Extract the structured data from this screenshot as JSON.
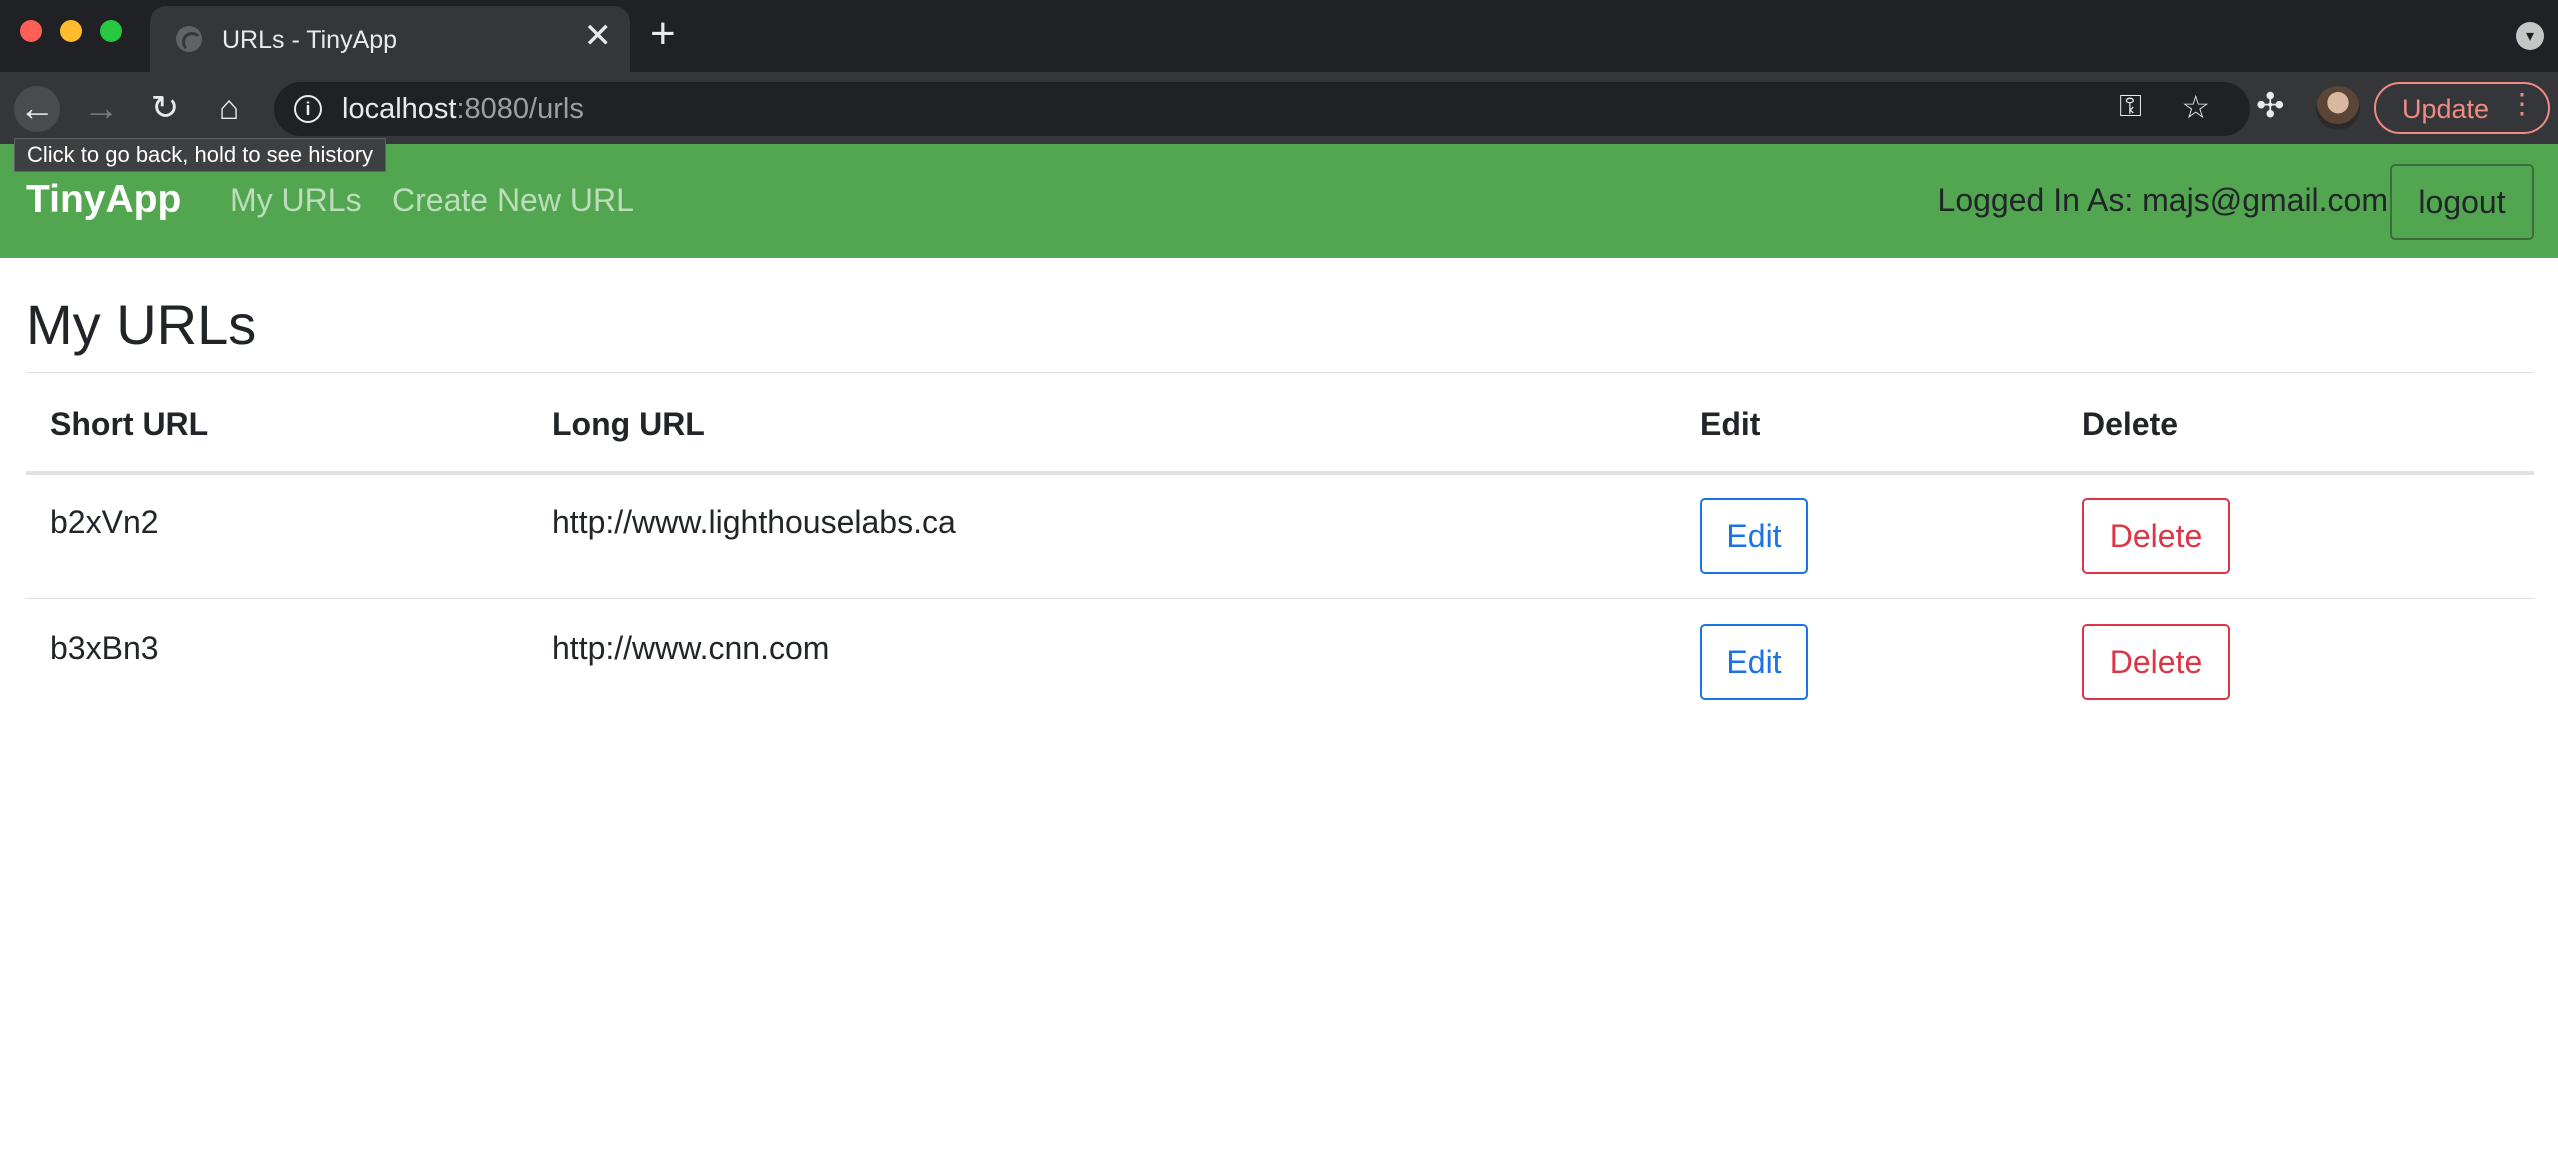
{
  "browser": {
    "tab_title": "URLs - TinyApp",
    "close_glyph": "✕",
    "new_tab_glyph": "+",
    "tab_menu_glyph": "▾",
    "back_glyph": "←",
    "forward_glyph": "→",
    "reload_glyph": "↻",
    "home_glyph": "⌂",
    "info_glyph": "i",
    "url_host": "localhost",
    "url_rest": ":8080/urls",
    "key_glyph": "⚿",
    "star_glyph": "☆",
    "extensions_glyph": "✣",
    "update_label": "Update",
    "menu_glyph": "⋮",
    "tooltip": "Click to go back, hold to see history"
  },
  "nav": {
    "brand": "TinyApp",
    "my_urls": "My URLs",
    "create_new": "Create New URL",
    "logged_in": "Logged In As: majs@gmail.com",
    "logout": "logout"
  },
  "main": {
    "title": "My URLs",
    "headers": [
      "Short URL",
      "Long URL",
      "Edit",
      "Delete"
    ],
    "rows": [
      {
        "short": "b2xVn2",
        "long": "http://www.lighthouselabs.ca",
        "edit": "Edit",
        "delete": "Delete"
      },
      {
        "short": "b3xBn3",
        "long": "http://www.cnn.com",
        "edit": "Edit",
        "delete": "Delete"
      }
    ]
  },
  "colors": {
    "navbar": "#52a650",
    "edit": "#1a73e8",
    "delete": "#dc3545",
    "chrome_dark": "#202124"
  },
  "icons": [
    "globe-icon",
    "close-icon",
    "plus-icon",
    "back-arrow-icon",
    "forward-arrow-icon",
    "reload-icon",
    "home-icon",
    "info-icon",
    "key-icon",
    "star-icon",
    "puzzle-icon",
    "avatar",
    "kebab-menu-icon"
  ]
}
